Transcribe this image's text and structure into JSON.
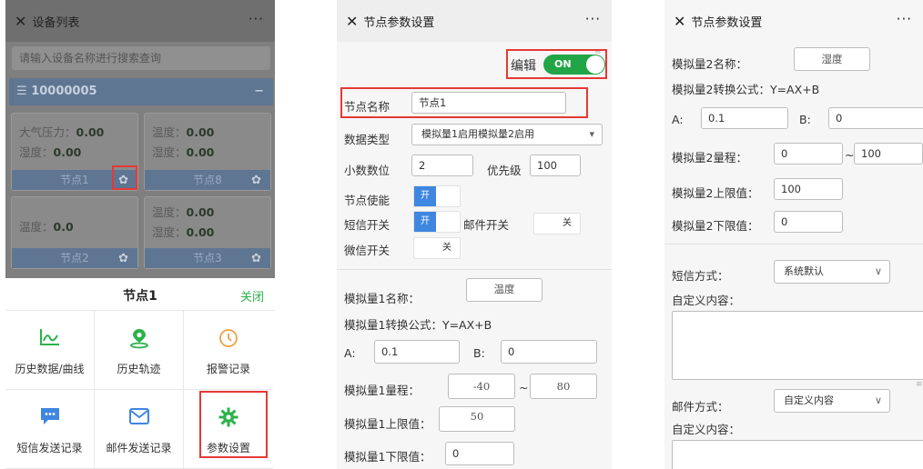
{
  "panel1": {
    "topbar": {
      "close_icon": "close-icon",
      "title": "设备列表",
      "more": "···"
    },
    "search_placeholder": "请输入设备名称进行搜索查询",
    "device": {
      "id": "10000005",
      "collapse": "−"
    },
    "cards": [
      {
        "lines": [
          {
            "k": "大气压力：",
            "v": "0.00"
          },
          {
            "k": "湿度：",
            "v": "0.00"
          }
        ],
        "node": "节点1"
      },
      {
        "lines": [
          {
            "k": "温度：",
            "v": "0.00"
          },
          {
            "k": "湿度：",
            "v": "0.00"
          }
        ],
        "node": "节点8"
      },
      {
        "lines": [
          {
            "k": "温度：",
            "v": "0.0"
          }
        ],
        "node": "节点2"
      },
      {
        "lines": [
          {
            "k": "温度：",
            "v": "0.00"
          },
          {
            "k": "湿度：",
            "v": "0.00"
          }
        ],
        "node": "节点3"
      }
    ],
    "sheet": {
      "title": "节点1",
      "close": "关闭"
    },
    "menu": [
      {
        "label": "历史数据/曲线",
        "icon": "chart-icon"
      },
      {
        "label": "历史轨迹",
        "icon": "location-pin-icon"
      },
      {
        "label": "报警记录",
        "icon": "alarm-clock-icon"
      },
      {
        "label": "短信发送记录",
        "icon": "sms-icon"
      },
      {
        "label": "邮件发送记录",
        "icon": "mail-icon"
      },
      {
        "label": "参数设置",
        "icon": "settings-gear-icon"
      }
    ]
  },
  "panel2": {
    "topbar": {
      "title": "节点参数设置",
      "more": "···"
    },
    "edit": {
      "label": "编辑",
      "switch": "ON"
    },
    "node_name": {
      "label": "节点名称",
      "value": "节点1"
    },
    "data_type": {
      "label": "数据类型",
      "value": "模拟量1启用模拟量2启用"
    },
    "decimal": {
      "label": "小数数位",
      "value": "2"
    },
    "priority": {
      "label": "优先级",
      "value": "100"
    },
    "node_enable": {
      "label": "节点使能",
      "state": "开"
    },
    "sms_switch": {
      "label": "短信开关",
      "state": "开"
    },
    "mail_switch": {
      "label": "邮件开关",
      "state": "关"
    },
    "wechat_switch": {
      "label": "微信开关",
      "state": "关"
    },
    "analog1_name": {
      "label": "模拟量1名称：",
      "value": "温度"
    },
    "analog1_formula": "模拟量1转换公式：Y=AX+B",
    "a": {
      "label": "A:",
      "value": "0.1"
    },
    "b": {
      "label": "B:",
      "value": "0"
    },
    "range": {
      "label": "模拟量1量程：",
      "min": "-40",
      "tilde": "~",
      "max": "80"
    },
    "upper": {
      "label": "模拟量1上限值：",
      "value": "50"
    },
    "lower": {
      "label": "模拟量1下限值：",
      "value": "0"
    }
  },
  "panel3": {
    "topbar": {
      "title": "节点参数设置",
      "more": "···"
    },
    "analog2_name": {
      "label": "模拟量2名称：",
      "value": "湿度"
    },
    "analog2_formula": "模拟量2转换公式：Y=AX+B",
    "a": {
      "label": "A:",
      "value": "0.1"
    },
    "b": {
      "label": "B:",
      "value": "0"
    },
    "range": {
      "label": "模拟量2量程：",
      "min": "0",
      "tilde": "~",
      "max": "100"
    },
    "upper": {
      "label": "模拟量2上限值：",
      "value": "100"
    },
    "lower": {
      "label": "模拟量2下限值：",
      "value": "0"
    },
    "sms_method": {
      "label": "短信方式：",
      "value": "系统默认"
    },
    "custom1": "自定义内容：",
    "mail_method": {
      "label": "邮件方式：",
      "value": "自定义内容"
    },
    "custom2": "自定义内容："
  }
}
